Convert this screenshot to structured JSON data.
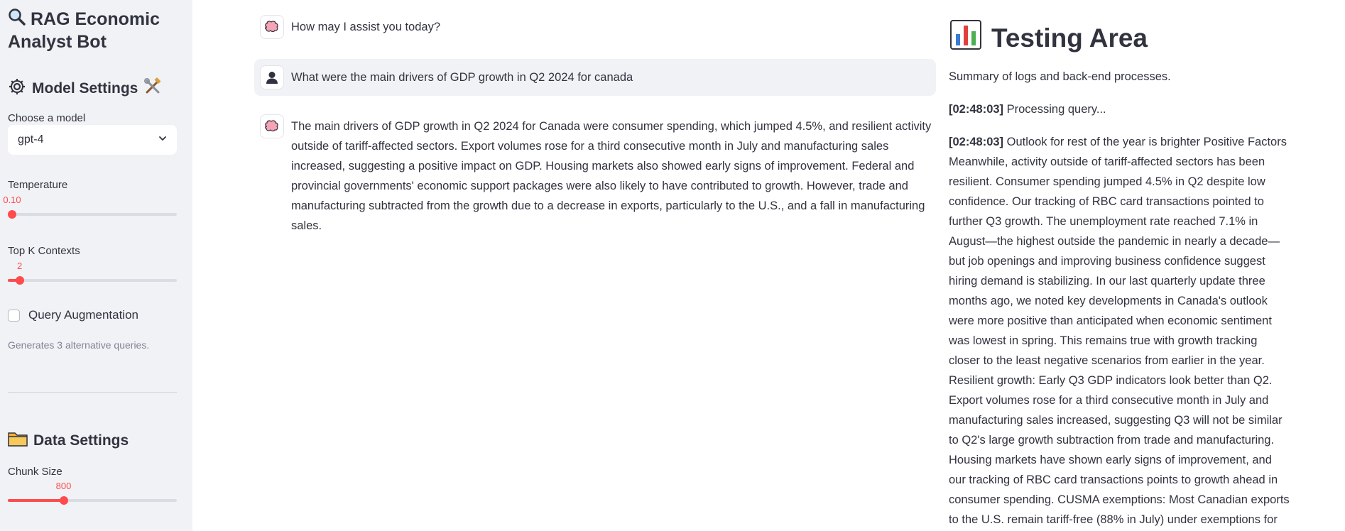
{
  "sidebar": {
    "title_line1": "RAG Economic",
    "title_line2": "Analyst Bot",
    "model_settings_heading": "Model Settings",
    "choose_model_label": "Choose a model",
    "selected_model": "gpt-4",
    "temperature_label": "Temperature",
    "temperature_value": "0.10",
    "temperature_fraction": 0.0,
    "topk_label": "Top K Contexts",
    "topk_value": "2",
    "topk_fraction": 0.07,
    "query_aug_label": "Query Augmentation",
    "query_aug_checked": false,
    "query_aug_help": "Generates 3 alternative queries.",
    "data_settings_heading": "Data Settings",
    "chunk_size_label": "Chunk Size",
    "chunk_size_value": "800",
    "chunk_size_fraction": 0.33
  },
  "chat": {
    "messages": [
      {
        "role": "assistant",
        "text": "How may I assist you today?"
      },
      {
        "role": "user",
        "text": "What were the main drivers of GDP growth in Q2 2024 for canada"
      },
      {
        "role": "assistant",
        "text": "The main drivers of GDP growth in Q2 2024 for Canada were consumer spending, which jumped 4.5%, and resilient activity outside of tariff-affected sectors. Export volumes rose for a third consecutive month in July and manufacturing sales increased, suggesting a positive impact on GDP. Housing markets also showed early signs of improvement. Federal and provincial governments' economic support packages were also likely to have contributed to growth. However, trade and manufacturing subtracted from the growth due to a decrease in exports, particularly to the U.S., and a fall in manufacturing sales."
      }
    ]
  },
  "testing": {
    "title": "Testing Area",
    "summary": "Summary of logs and back-end processes.",
    "logs": [
      {
        "time": "[02:48:03]",
        "text": " Processing query..."
      },
      {
        "time": "[02:48:03]",
        "text": " Outlook for rest of the year is brighter Positive Factors Meanwhile, activity outside of tariff-affected sectors has been resilient. Consumer spending jumped 4.5% in Q2 despite low confidence. Our tracking of RBC card transactions pointed to further Q3 growth. The unemployment rate reached 7.1% in August—the highest outside the pandemic in nearly a decade—but job openings and improving business confidence suggest hiring demand is stabilizing. In our last quarterly update three months ago, we noted key developments in Canada's outlook were more positive than anticipated when economic sentiment was lowest in spring. This remains true with growth tracking closer to the least negative scenarios from earlier in the year. Resilient growth: Early Q3 GDP indicators look better than Q2. Export volumes rose for a third consecutive month in July and manufacturing sales increased, suggesting Q3 will not be similar to Q2's large growth subtraction from trade and manufacturing. Housing markets have shown early signs of improvement, and our tracking of RBC card transactions points to growth ahead in consumer spending. CUSMA exemptions: Most Canadian exports to the U.S. remain tariff-free (88% in July) under exemptions for"
      }
    ]
  },
  "colors": {
    "sidebar_bg": "#f0f2f6",
    "accent": "#ff4b4b",
    "text": "#31333f",
    "muted": "#808495"
  },
  "icons": {
    "title": "magnifier-icon",
    "model_settings": "gear-icon",
    "model_tools": "tools-icon",
    "data_settings": "folder-icon",
    "assistant_avatar": "brain-icon",
    "user_avatar": "user-icon",
    "testing": "bar-chart-icon"
  }
}
